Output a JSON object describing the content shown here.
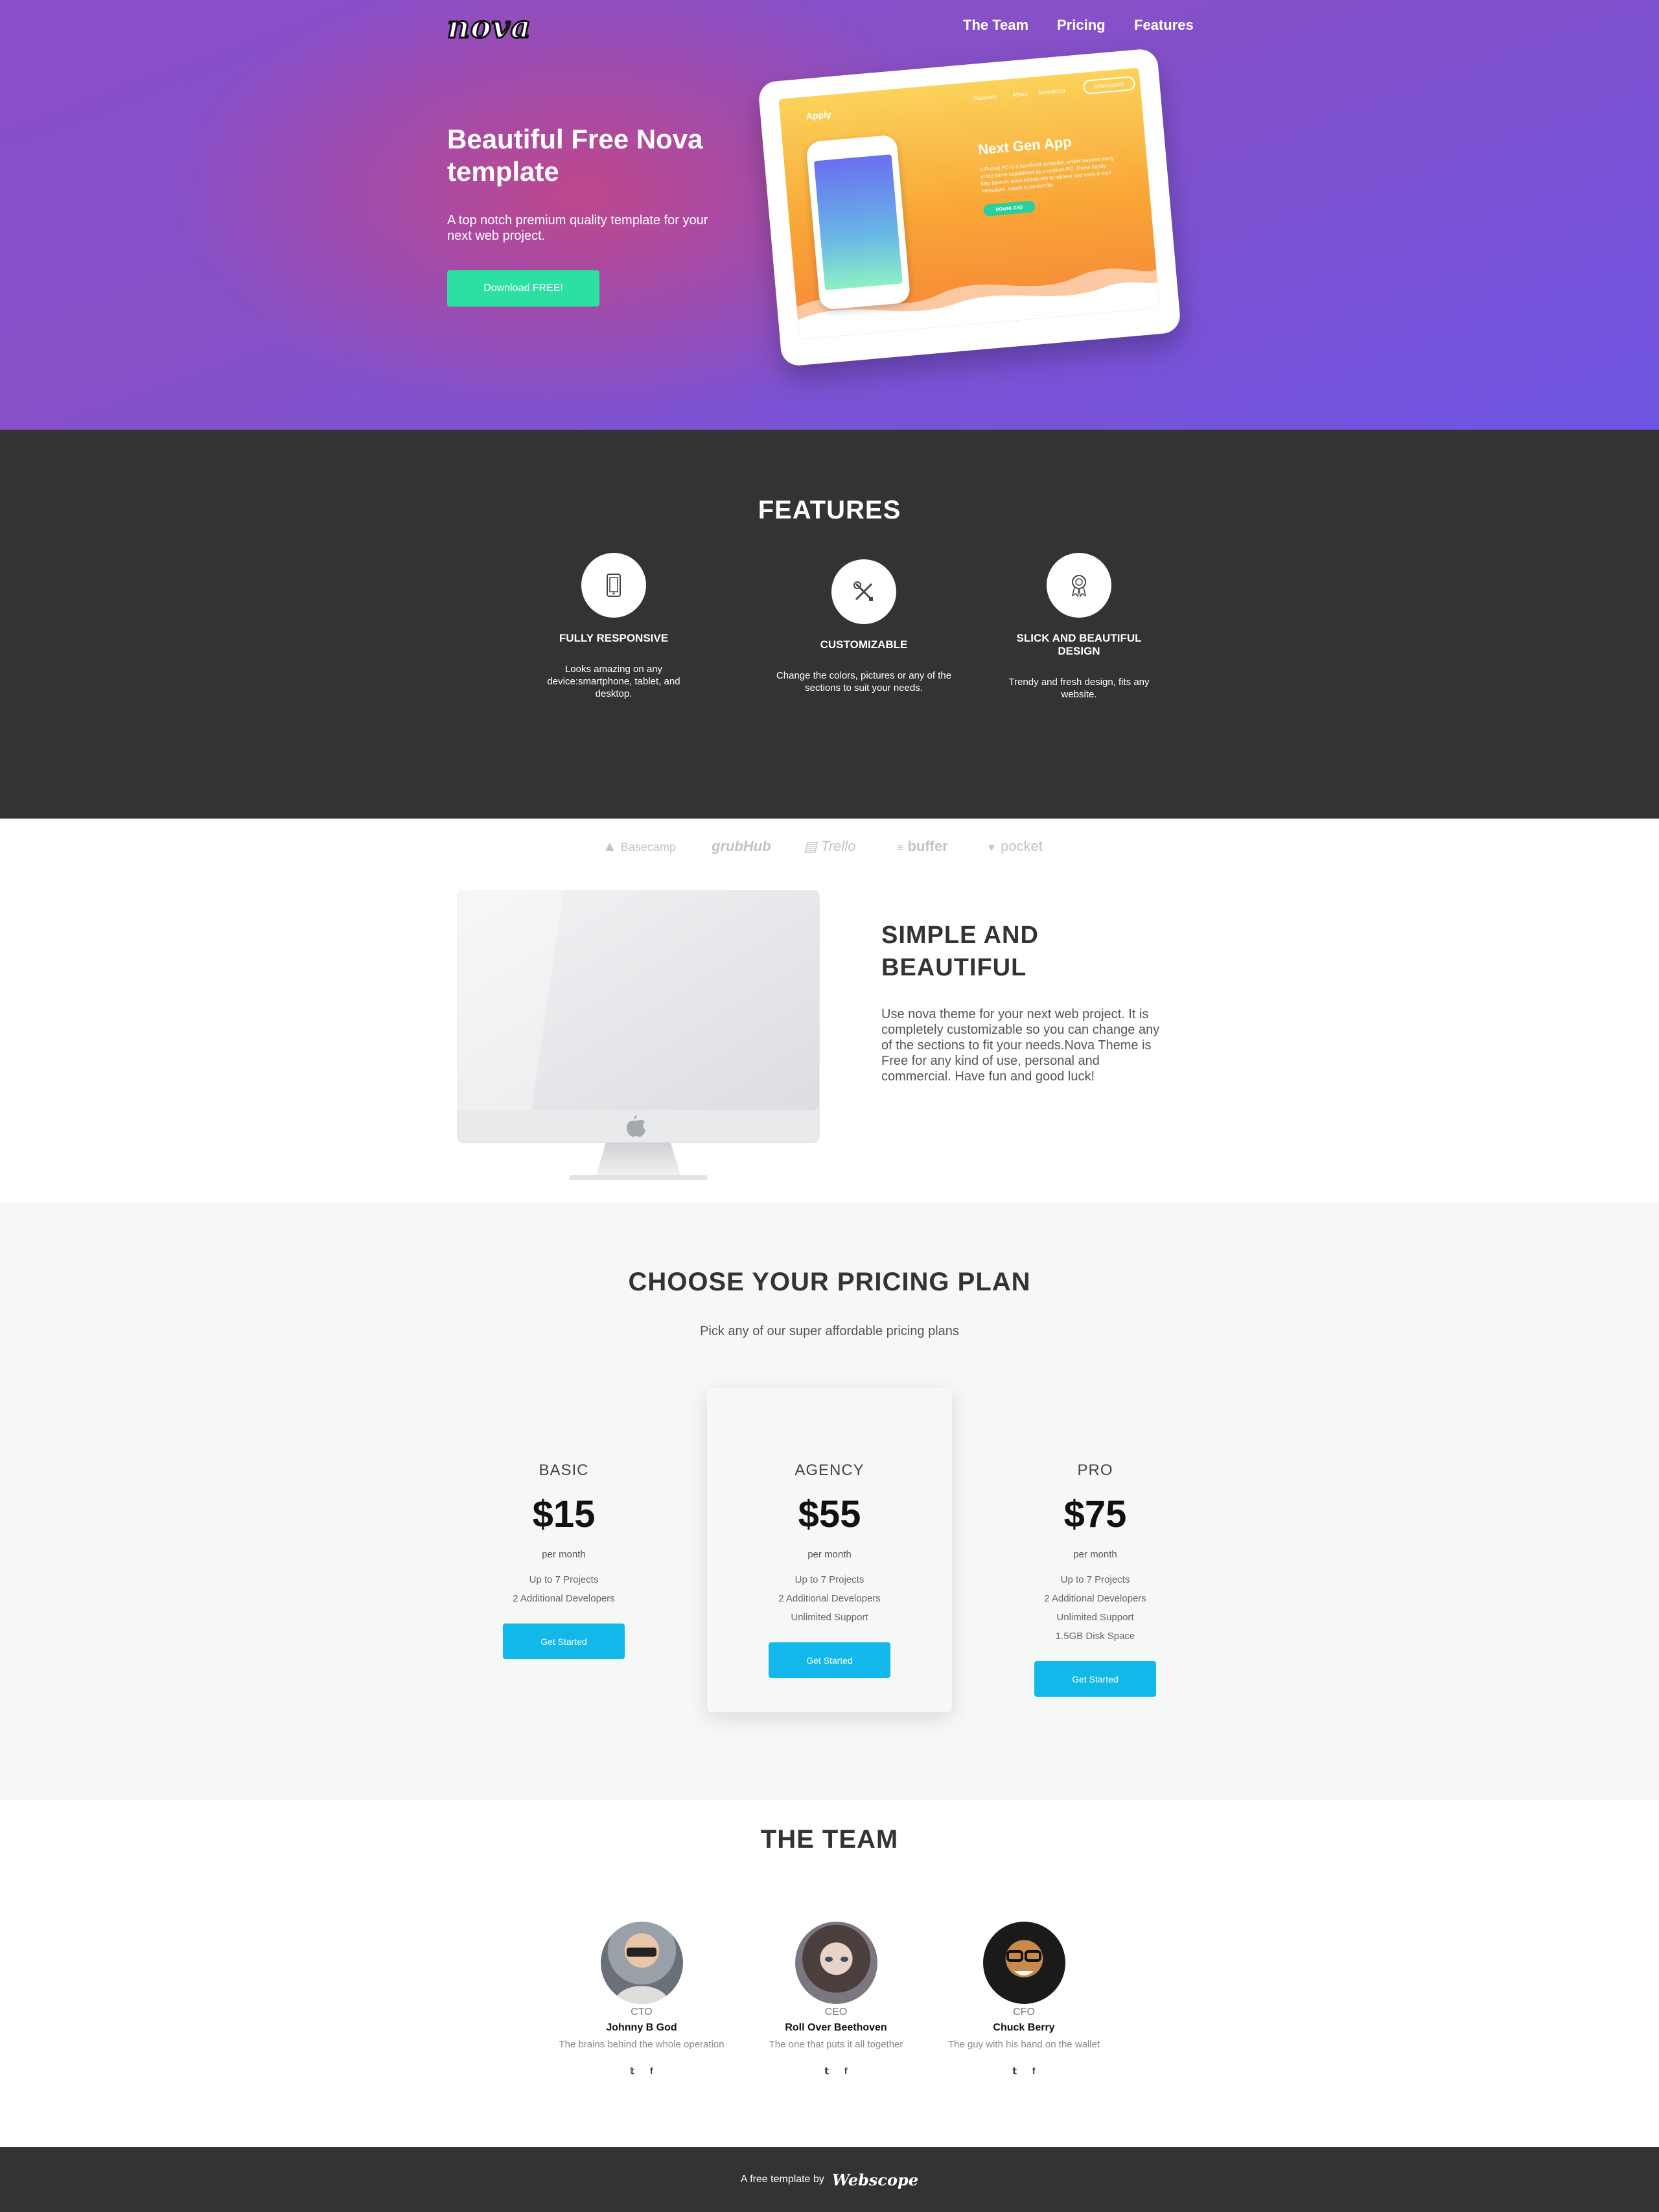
{
  "header": {
    "logo": "nova",
    "nav": [
      "The Team",
      "Pricing",
      "Features"
    ]
  },
  "hero": {
    "title": "Beautiful Free Nova template",
    "subtitle": "A top notch premium quality template for your next web project.",
    "cta": "Download FREE!",
    "mockup": {
      "brand": "Apply",
      "nav": [
        "Features",
        "About",
        "Newsletter"
      ],
      "nav_button": "DOWNLOAD",
      "title": "Next Gen App",
      "text": "A Pocket PC is a handheld computer, which features many of the same capabilities as a modern PC. These handy little devices allow individuals to retrieve and store e-mail messages, create a contact file",
      "button": "DOWNLOAD"
    }
  },
  "features": {
    "title": "FEATURES",
    "items": [
      {
        "icon": "smartphone-icon",
        "title": "FULLY RESPONSIVE",
        "desc": "Looks amazing on any device:smartphone, tablet, and desktop."
      },
      {
        "icon": "tools-icon",
        "title": "CUSTOMIZABLE",
        "desc": "Change the colors, pictures or any of the sections to suit your needs."
      },
      {
        "icon": "award-icon",
        "title": "SLICK AND BEAUTIFUL DESIGN",
        "desc": "Trendy and fresh design, fits any website."
      }
    ]
  },
  "logos": [
    "Basecamp",
    "grubHub",
    "Trello",
    "buffer",
    "pocket"
  ],
  "simple": {
    "title": "SIMPLE AND BEAUTIFUL",
    "text": "Use nova theme for your next web project. It is completely customizable so you can change any of the sections to fit your needs.Nova Theme is Free for any kind of use, personal and commercial. Have fun and good luck!"
  },
  "pricing": {
    "title": "CHOOSE YOUR PRICING PLAN",
    "subtitle": "Pick any of our super affordable pricing plans",
    "plans": [
      {
        "name": "BASIC",
        "price": "$15",
        "period": "per month",
        "features": [
          "Up to 7 Projects",
          "2 Additional Developers"
        ],
        "button": "Get Started"
      },
      {
        "name": "AGENCY",
        "price": "$55",
        "period": "per month",
        "features": [
          "Up to 7 Projects",
          "2 Additional Developers",
          "Unlimited Support"
        ],
        "button": "Get Started"
      },
      {
        "name": "PRO",
        "price": "$75",
        "period": "per month",
        "features": [
          "Up to 7 Projects",
          "2 Additional Developers",
          "Unlimited Support",
          "1.5GB Disk Space"
        ],
        "button": "Get Started"
      }
    ]
  },
  "team": {
    "title": "THE TEAM",
    "members": [
      {
        "role": "CTO",
        "name": "Johnny B God",
        "desc": "The brains behind the whole operation"
      },
      {
        "role": "CEO",
        "name": "Roll Over Beethoven",
        "desc": "The one that puts it all together"
      },
      {
        "role": "CFO",
        "name": "Chuck Berry",
        "desc": "The guy with his hand on the wallet"
      }
    ],
    "social": [
      "twitter-icon",
      "facebook-icon"
    ]
  },
  "footer": {
    "text": "A free template by",
    "brand": "Webscope"
  },
  "colors": {
    "hero_gradient_start": "#8a4ec9",
    "hero_gradient_end": "#6e54e2",
    "cta_green": "#2be0a0",
    "button_blue": "#13b8ea",
    "dark_section": "#333333"
  }
}
